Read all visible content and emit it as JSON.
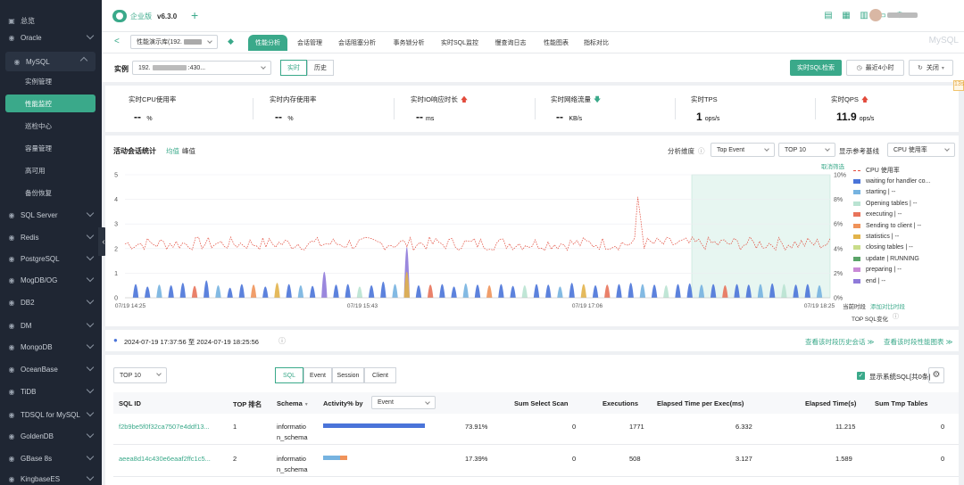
{
  "sidebar": {
    "items": [
      {
        "label": "总览",
        "icon": "overview-icon",
        "glyph": "▣",
        "expandable": false
      },
      {
        "label": "Oracle",
        "icon": "database-icon",
        "glyph": "◉",
        "expandable": true
      },
      {
        "label": "MySQL",
        "icon": "database-icon",
        "glyph": "◉",
        "expandable": true,
        "expanded": true
      },
      {
        "label": "SQL Server",
        "icon": "database-icon",
        "glyph": "◉",
        "expandable": true
      },
      {
        "label": "Redis",
        "icon": "database-icon",
        "glyph": "◉",
        "expandable": true
      },
      {
        "label": "PostgreSQL",
        "icon": "database-icon",
        "glyph": "◉",
        "expandable": true
      },
      {
        "label": "MogDB/OG",
        "icon": "database-icon",
        "glyph": "◉",
        "expandable": true
      },
      {
        "label": "DB2",
        "icon": "database-icon",
        "glyph": "◉",
        "expandable": true
      },
      {
        "label": "DM",
        "icon": "database-icon",
        "glyph": "◉",
        "expandable": true
      },
      {
        "label": "MongoDB",
        "icon": "database-icon",
        "glyph": "◉",
        "expandable": true
      },
      {
        "label": "OceanBase",
        "icon": "database-icon",
        "glyph": "◉",
        "expandable": true
      },
      {
        "label": "TiDB",
        "icon": "database-icon",
        "glyph": "◉",
        "expandable": true
      },
      {
        "label": "TDSQL for MySQL",
        "icon": "database-icon",
        "glyph": "◉",
        "expandable": true
      },
      {
        "label": "GoldenDB",
        "icon": "database-icon",
        "glyph": "◉",
        "expandable": true
      },
      {
        "label": "GBase 8s",
        "icon": "database-icon",
        "glyph": "◉",
        "expandable": true
      },
      {
        "label": "KingbaseES",
        "icon": "database-icon",
        "glyph": "◉",
        "expandable": true
      }
    ],
    "mysql_sub": [
      "实例管理",
      "性能监控",
      "巡检中心",
      "容量管理",
      "高可用",
      "备份恢复"
    ],
    "active_sub": 1
  },
  "topbar": {
    "brand": "企业版",
    "version": "v6.3.0",
    "plus": "+",
    "icons": [
      "document-icon",
      "calendar-icon",
      "chart-icon",
      "monitor-icon",
      "gear-icon"
    ],
    "icon_glyphs": [
      "▤",
      "▦",
      "▥",
      "▭",
      "⚙"
    ]
  },
  "tabsbar": {
    "back": "<",
    "instance": "性能演示库(192.",
    "tabs": [
      "性能分析",
      "会话管理",
      "会话阻塞分析",
      "事务锁分析",
      "实时SQL监控",
      "慢查询日志",
      "性能图表",
      "指标对比"
    ],
    "active_tab": 0,
    "watermark": "MySQL"
  },
  "instance_row": {
    "label": "实例",
    "value": "192.",
    "value_tail": ":430...",
    "modes": [
      "实时",
      "历史"
    ],
    "active_mode": 0,
    "realtime_sql_btn": "实时SQL检索",
    "range_btn": "最近4小时",
    "refresh_btn": "关闭",
    "badge": "13s"
  },
  "metrics": [
    {
      "label": "实时CPU使用率",
      "value": "-- ",
      "unit": "%",
      "trend": ""
    },
    {
      "label": "实时内存使用率",
      "value": "-- ",
      "unit": "%",
      "trend": ""
    },
    {
      "label": "实时IO响应时长",
      "value": "--",
      "unit": "ms",
      "trend": "up"
    },
    {
      "label": "实时网络流量",
      "value": "-- ",
      "unit": "KB/s",
      "trend": "down"
    },
    {
      "label": "实时TPS",
      "value": "1",
      "unit": "ops/s",
      "trend": ""
    },
    {
      "label": "实时QPS",
      "value": "11.9",
      "unit": "ops/s",
      "trend": "up"
    }
  ],
  "chart_panel": {
    "title": "活动会话统计",
    "mode_links": [
      "均值",
      "峰值"
    ],
    "active_mode": 0,
    "dimension_label": "分析维度",
    "dimension_value": "Top Event",
    "top_value": "TOP 10",
    "ref_label": "显示参考基线",
    "ref_value": "CPU 使用率",
    "cancel_select": "取消筛选",
    "current_period": "当前时段",
    "add_compare": "添加对比时段",
    "top_sql_change": "TOP SQL变化"
  },
  "chart_data": {
    "type": "area",
    "x_ticks": [
      "07/19 14:25",
      "07/19 15:43",
      "07/19 17:06",
      "07/19 18:25"
    ],
    "y_left_ticks": [
      "0",
      "1",
      "2",
      "3",
      "4",
      "5"
    ],
    "y_right_ticks": [
      "0%",
      "2%",
      "4%",
      "6%",
      "8%",
      "10%"
    ],
    "ylim_left": [
      0,
      5
    ],
    "ylim_right": [
      0,
      10
    ],
    "legend_position": "right",
    "series": [
      {
        "name": "CPU 使用率",
        "style": "dashed-line",
        "color": "#e24a3b"
      },
      {
        "name": "waiting for handler co...",
        "color": "#4a74d9"
      },
      {
        "name": "starting | --",
        "color": "#76b3e0"
      },
      {
        "name": "Opening tables | --",
        "color": "#b9e3d2"
      },
      {
        "name": "executing | --",
        "color": "#e8735a"
      },
      {
        "name": "Sending to client | --",
        "color": "#f0935a"
      },
      {
        "name": "statistics | --",
        "color": "#e2b34a"
      },
      {
        "name": "closing tables | --",
        "color": "#c9dd8a"
      },
      {
        "name": "update | RUNNING",
        "color": "#5aa468"
      },
      {
        "name": "preparing | --",
        "color": "#c98ad6"
      },
      {
        "name": "end | --",
        "color": "#8f7ad9"
      }
    ],
    "spike_peaks": [
      0.9,
      0.7,
      0.85,
      0.8,
      1.0,
      0.75,
      1.2,
      0.8,
      0.6,
      0.9,
      0.85,
      0.7,
      1.0,
      0.9,
      0.8,
      0.75,
      1.9,
      0.85,
      0.9,
      0.7,
      0.8,
      1.1,
      0.9,
      3.9,
      0.8,
      0.85,
      0.9,
      0.7,
      0.95,
      0.85,
      0.8,
      0.9,
      0.75,
      0.8,
      0.9,
      0.85,
      0.7,
      1.0,
      0.9,
      0.8,
      0.85,
      0.9,
      1.0,
      0.9,
      0.85,
      0.8,
      0.9,
      0.95,
      0.85,
      0.9,
      0.8,
      0.9,
      0.85,
      0.9,
      0.95,
      0.9,
      0.85,
      0.9,
      0.8
    ],
    "cpu_baseline_pct": 4.4,
    "cpu_spike_pct": 8.2,
    "selection_range": [
      "07/19 17:37:56",
      "07/19 18:25:56"
    ]
  },
  "time_row": {
    "range_text": "2024-07-19 17:37:56 至 2024-07-19 18:25:56",
    "link1": "查看该时段历史会话 ≫",
    "link2": "查看该时段性能图表 ≫"
  },
  "table_panel": {
    "top": "TOP 10",
    "filters": [
      "SQL",
      "Event",
      "Session",
      "Client"
    ],
    "active_filter": 0,
    "show_system_sql": "显示系统SQL[共0条]",
    "activity_by": "Event",
    "headers": [
      "SQL ID",
      "TOP 排名",
      "Schema",
      "Activity% by",
      "Sum Select Scan",
      "Executions",
      "Elapsed Time per Exec(ms)",
      "Elapsed Time(s)",
      "Sum Tmp Tables"
    ],
    "rows": [
      {
        "sql_id": "f2b9be5f0f32ca7507e4ddf13...",
        "rank": "1",
        "schema_1": "informatio",
        "schema_2": "n_schema",
        "activity": "73.91%",
        "activity_frac": 0.7391,
        "select_scan": "0",
        "executions": "1771",
        "elapsed_per_exec": "6.332",
        "elapsed": "11.215",
        "tmp_tables": "0"
      },
      {
        "sql_id": "aeea8d14c430e6eaaf2ffc1c5...",
        "rank": "2",
        "schema_1": "informatio",
        "schema_2": "n_schema",
        "activity": "17.39%",
        "activity_frac": 0.1739,
        "select_scan": "0",
        "executions": "508",
        "elapsed_per_exec": "3.127",
        "elapsed": "1.589",
        "tmp_tables": "0"
      }
    ]
  }
}
